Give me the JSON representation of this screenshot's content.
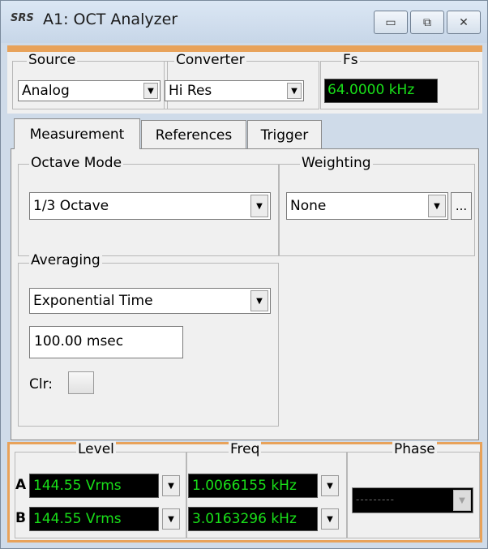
{
  "window": {
    "logo_text": "SRS",
    "title": "A1: OCT Analyzer",
    "controls": {
      "minimize_icon": "minimize-icon",
      "restore_icon": "restore-icon",
      "close_icon": "close-icon"
    }
  },
  "top": {
    "source": {
      "label": "Source",
      "value": "Analog"
    },
    "converter": {
      "label": "Converter",
      "value": "Hi Res"
    },
    "fs": {
      "label": "Fs",
      "value": "64.0000 kHz"
    }
  },
  "tabs": [
    {
      "label": "Measurement"
    },
    {
      "label": "References"
    },
    {
      "label": "Trigger"
    }
  ],
  "measurement": {
    "octave_mode": {
      "label": "Octave Mode",
      "value": "1/3 Octave"
    },
    "weighting": {
      "label": "Weighting",
      "value": "None",
      "more_label": "..."
    },
    "averaging": {
      "label": "Averaging",
      "type": "Exponential Time",
      "time": "100.00 msec",
      "clear_label": "Clr:"
    }
  },
  "meters": {
    "level_header": "Level",
    "freq_header": "Freq",
    "phase_header": "Phase",
    "rows": [
      {
        "channel": "A",
        "level": "144.55 Vrms",
        "freq": "1.0066155 kHz"
      },
      {
        "channel": "B",
        "level": "144.55 Vrms",
        "freq": "3.0163296 kHz"
      }
    ],
    "phase_value": "---------"
  },
  "colors": {
    "accent": "#e8a25a",
    "display_bg": "#000000",
    "display_text": "#19e019"
  }
}
